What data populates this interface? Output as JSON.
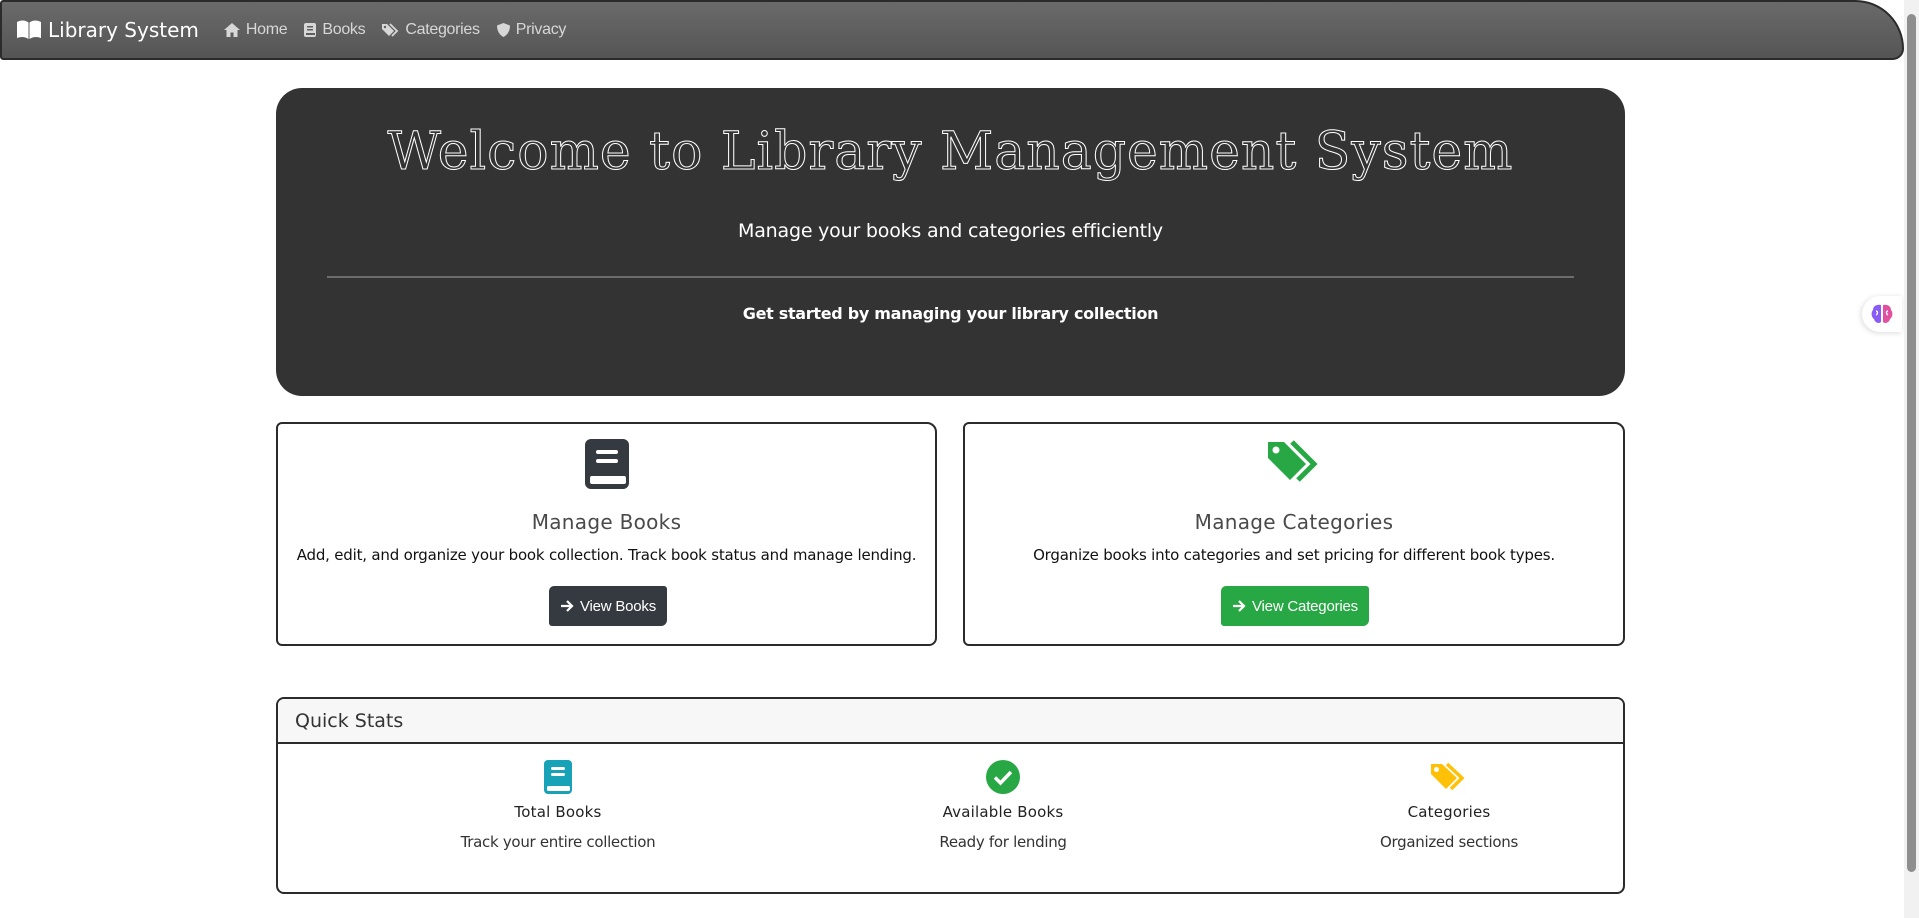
{
  "navbar": {
    "brand": "Library System",
    "items": [
      {
        "label": "Home",
        "icon": "home-icon"
      },
      {
        "label": "Books",
        "icon": "book-icon"
      },
      {
        "label": "Categories",
        "icon": "tags-icon"
      },
      {
        "label": "Privacy",
        "icon": "shield-icon"
      }
    ]
  },
  "hero": {
    "title": "Welcome to Library Management System",
    "subtitle": "Manage your books and categories efficiently",
    "lead": "Get started by managing your library collection"
  },
  "cards": [
    {
      "title": "Manage Books",
      "text": "Add, edit, and organize your book collection. Track book status and manage lending.",
      "button": "View Books",
      "icon": "book-icon",
      "accent": "#343a40"
    },
    {
      "title": "Manage Categories",
      "text": "Organize books into categories and set pricing for different book types.",
      "button": "View Categories",
      "icon": "tags-icon",
      "accent": "#28a745"
    }
  ],
  "stats": {
    "header": "Quick Stats",
    "items": [
      {
        "label": "Total Books",
        "desc": "Track your entire collection",
        "icon": "book-icon",
        "color": "#17a2b8"
      },
      {
        "label": "Available Books",
        "desc": "Ready for lending",
        "icon": "check-circle-icon",
        "color": "#28a745"
      },
      {
        "label": "Categories",
        "desc": "Organized sections",
        "icon": "tags-icon",
        "color": "#ffc107"
      }
    ]
  },
  "colors": {
    "navbar": "#5e5e5e",
    "hero_bg": "#333333",
    "primary_dark": "#343a40",
    "success": "#28a745",
    "info": "#17a2b8",
    "warning": "#ffc107"
  }
}
